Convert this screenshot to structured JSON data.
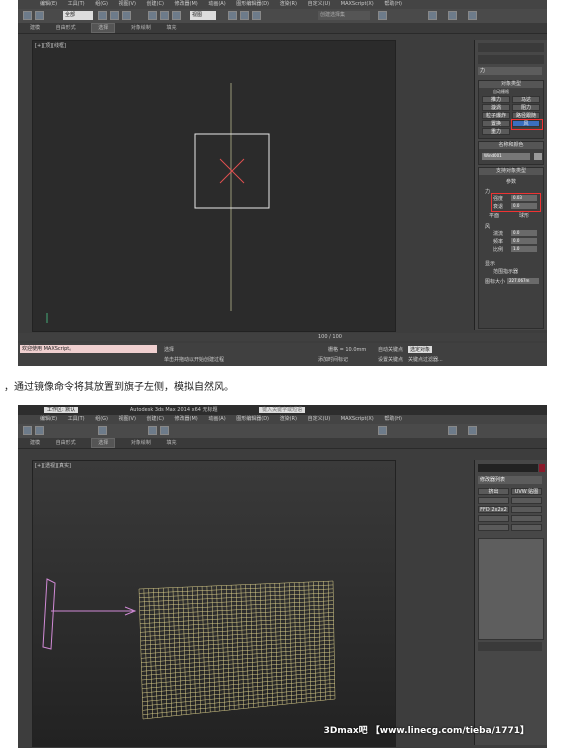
{
  "shot1": {
    "menu": [
      "编辑(E)",
      "工具(T)",
      "组(G)",
      "视图(V)",
      "创建(C)",
      "修改器(M)",
      "动画(A)",
      "图形编辑器(D)",
      "渲染(R)",
      "自定义(U)",
      "MAXScript(X)",
      "帮助(H)"
    ],
    "toolbar": {
      "filter_value": "全部",
      "view_value": "视图",
      "named_sel_placeholder": "创建选择集"
    },
    "ribbon": [
      "建模",
      "自由形式",
      "选择",
      "对象绘制",
      "填充"
    ],
    "ribbon_selected": "选择",
    "viewport_label": "[+][顶][线框]",
    "panel": {
      "dropdown": "力",
      "object_type": {
        "header": "对象类型",
        "autogrid": "自动栅格",
        "buttons": [
          "推力",
          "马达",
          "漩涡",
          "阻力",
          "粒子爆炸",
          "路径跟随",
          "置换",
          "风",
          "重力"
        ],
        "active": "风"
      },
      "name_color": {
        "header": "名称和颜色",
        "name": "Wind001"
      },
      "support_type": {
        "header": "支持对象类型"
      },
      "params": {
        "header": "参数",
        "force_label": "力",
        "strength_label": "强度",
        "strength": "0.03",
        "decay_label": "衰退",
        "decay": "0.0",
        "planar": "平面",
        "spherical": "球形"
      },
      "wind": {
        "label": "风",
        "turbulence_label": "湍流",
        "turbulence": "0.0",
        "frequency_label": "频率",
        "frequency": "0.0",
        "scale_label": "比例",
        "scale": "1.0"
      },
      "display": {
        "label": "显示",
        "icon_toggle": "范围指示器",
        "icon_size_label": "图标大小",
        "icon_size": "227.067m"
      }
    },
    "timeline": "100 / 100",
    "status": {
      "script": "欢迎使用 MAXScript。",
      "hint": "单击并拖动以开始创建过程",
      "selected": "选择",
      "grid": "栅格 = 10.0mm",
      "autokey": "自动关键点",
      "keymode": "选定对象",
      "setkey": "设置关键点",
      "keyfilter": "关键点过滤器...",
      "addtime": "添加时间标记"
    }
  },
  "caption": "，通过镜像命令将其放置到旗子左侧，模拟自然风。",
  "shot2": {
    "title": "Autodesk 3ds Max  2014 x64     无标题",
    "search_placeholder": "键入关键字或短语",
    "workspace": "工作区: 默认",
    "menu": [
      "编辑(E)",
      "工具(T)",
      "组(G)",
      "视图(V)",
      "创建(C)",
      "修改器(M)",
      "动画(A)",
      "图形编辑器(D)",
      "渲染(R)",
      "自定义(U)",
      "MAXScript(X)",
      "帮助(H)"
    ],
    "ribbon": [
      "建模",
      "自由形式",
      "选择",
      "对象绘制",
      "填充"
    ],
    "ribbon_selected": "选择",
    "viewport_label": "[+][透视][真实]",
    "panel": {
      "dropdown": "修改器列表",
      "buttons": [
        "挤出",
        "UVW 贴图",
        "",
        "FFD 2x2x2",
        "",
        "",
        "",
        "",
        ""
      ]
    },
    "watermark": "3Dmax吧 【www.linecg.com/tieba/1771】"
  }
}
